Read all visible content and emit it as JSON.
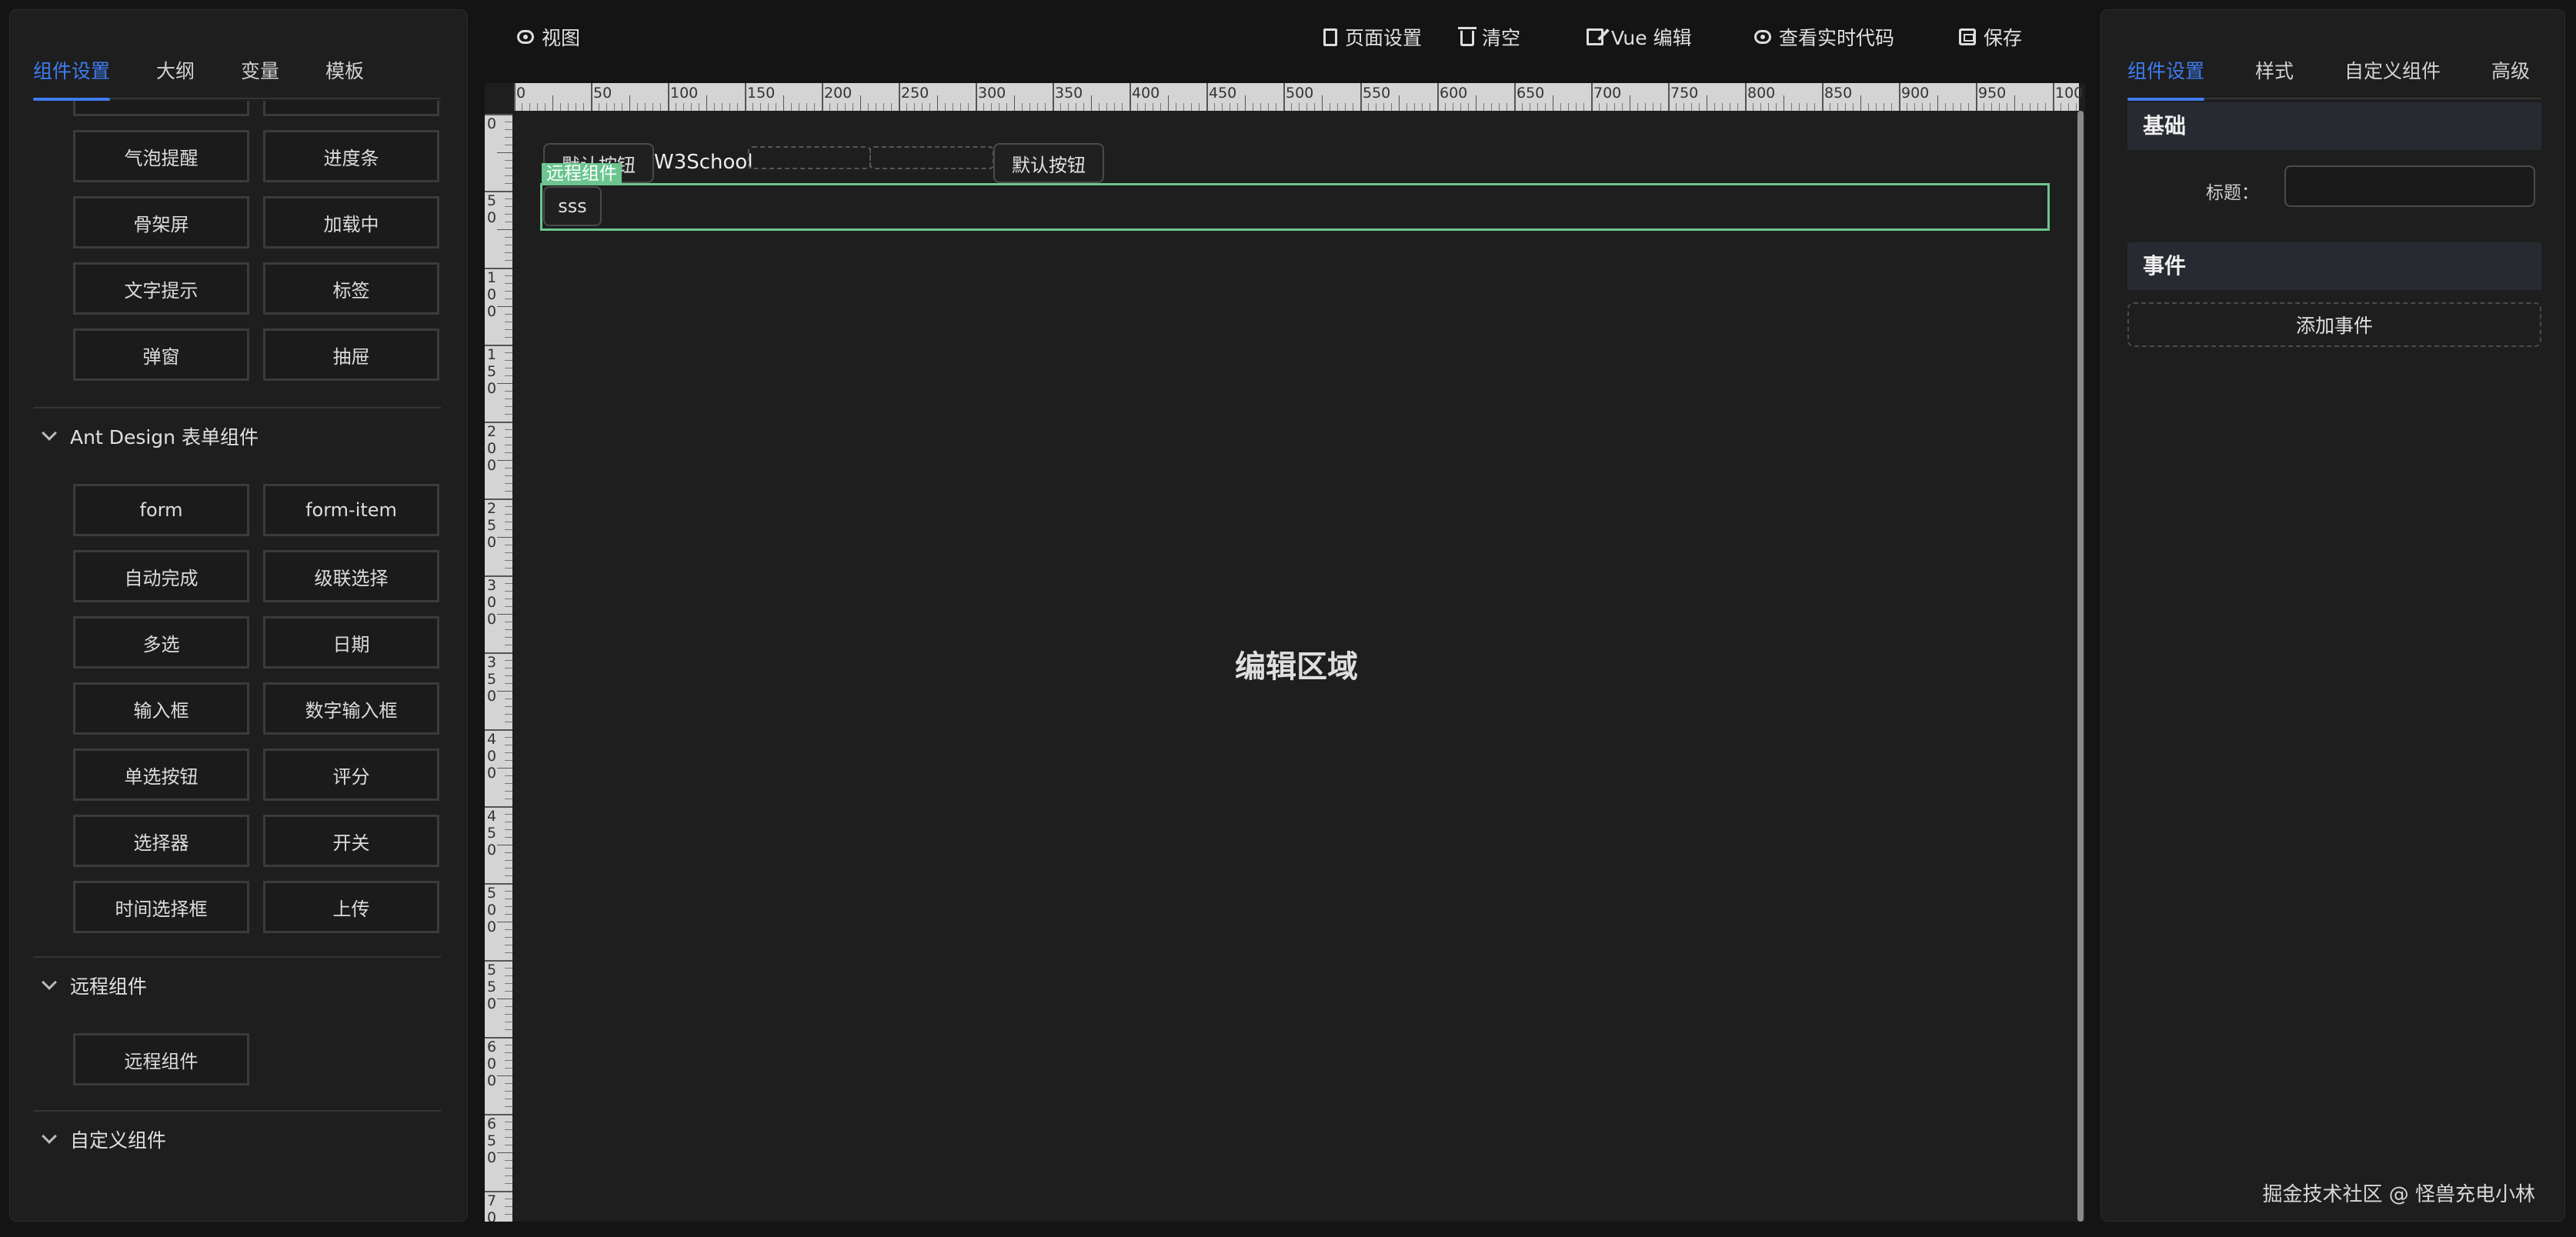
{
  "left_panel": {
    "tabs": [
      "组件设置",
      "大纲",
      "变量",
      "模板"
    ],
    "basic_items": [
      "气泡提醒",
      "进度条",
      "骨架屏",
      "加载中",
      "文字提示",
      "标签",
      "弹窗",
      "抽屉"
    ],
    "sections": [
      {
        "title": "Ant Design 表单组件",
        "items": [
          "form",
          "form-item",
          "自动完成",
          "级联选择",
          "多选",
          "日期",
          "输入框",
          "数字输入框",
          "单选按钮",
          "评分",
          "选择器",
          "开关",
          "时间选择框",
          "上传"
        ]
      },
      {
        "title": "远程组件",
        "items": [
          "远程组件"
        ]
      },
      {
        "title": "自定义组件",
        "items": []
      }
    ]
  },
  "toolbar": {
    "view": "视图",
    "page_settings": "页面设置",
    "clear": "清空",
    "vue_edit": "Vue 编辑",
    "view_code": "查看实时代码",
    "save": "保存"
  },
  "ruler": {
    "h_labels": [
      "0",
      "50",
      "100",
      "150",
      "200",
      "250",
      "300",
      "350",
      "400",
      "450",
      "500",
      "550",
      "600",
      "650",
      "700",
      "750",
      "800",
      "850",
      "900",
      "950",
      "100"
    ],
    "v_labels": [
      "0",
      "50",
      "100",
      "150",
      "200",
      "250",
      "300",
      "350",
      "400",
      "450",
      "500",
      "550",
      "600",
      "650",
      "700"
    ]
  },
  "canvas": {
    "button1": "默认按钮",
    "text1": "W3School",
    "button2": "默认按钮",
    "remote_tag": "远程组件",
    "sss_button": "sss",
    "center_label": "编辑区域"
  },
  "right_panel": {
    "tabs": [
      "组件设置",
      "样式",
      "自定义组件",
      "高级"
    ],
    "basic_title": "基础",
    "title_label": "标题：",
    "title_value": "",
    "events_title": "事件",
    "add_event": "添加事件",
    "watermark": "掘金技术社区 @ 怪兽充电小林"
  },
  "colors": {
    "accent": "#3f7cf0",
    "remote_highlight": "#6cc58f",
    "background": "#141414",
    "panel": "#1e1e1e"
  }
}
